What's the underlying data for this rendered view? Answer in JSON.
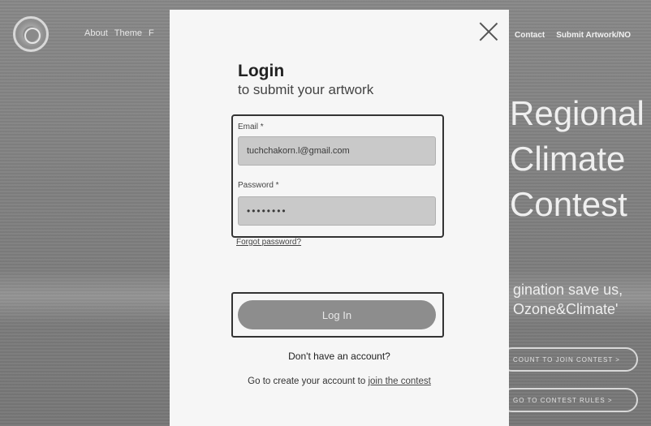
{
  "background": {
    "nav_left": [
      "About",
      "Theme",
      "F"
    ],
    "nav_right": [
      "Contact",
      "Submit Artwork/NO"
    ],
    "hero_lines": [
      "Regional",
      "Climate",
      "Contest"
    ],
    "subtitle_lines": [
      "gination save us,",
      "Ozone&Climate'"
    ],
    "pill1_label": "COUNT TO JOIN CONTEST  >",
    "pill2_label": "GO TO CONTEST RULES  >"
  },
  "modal": {
    "title": "Login",
    "subtitle": "to submit your artwork",
    "email_label": "Email *",
    "email_value": "tuchchakorn.l@gmail.com",
    "password_label": "Password *",
    "password_value": "••••••••",
    "forgot_link": "Forgot password?",
    "login_button": "Log In",
    "no_account_text": "Don't have an account?",
    "create_text": "Go to create your account to",
    "join_link": "join the contest"
  },
  "colors": {
    "modal_bg": "#f6f6f6",
    "field_bg": "#c9c9c9",
    "button_bg": "#8d8d8d"
  }
}
